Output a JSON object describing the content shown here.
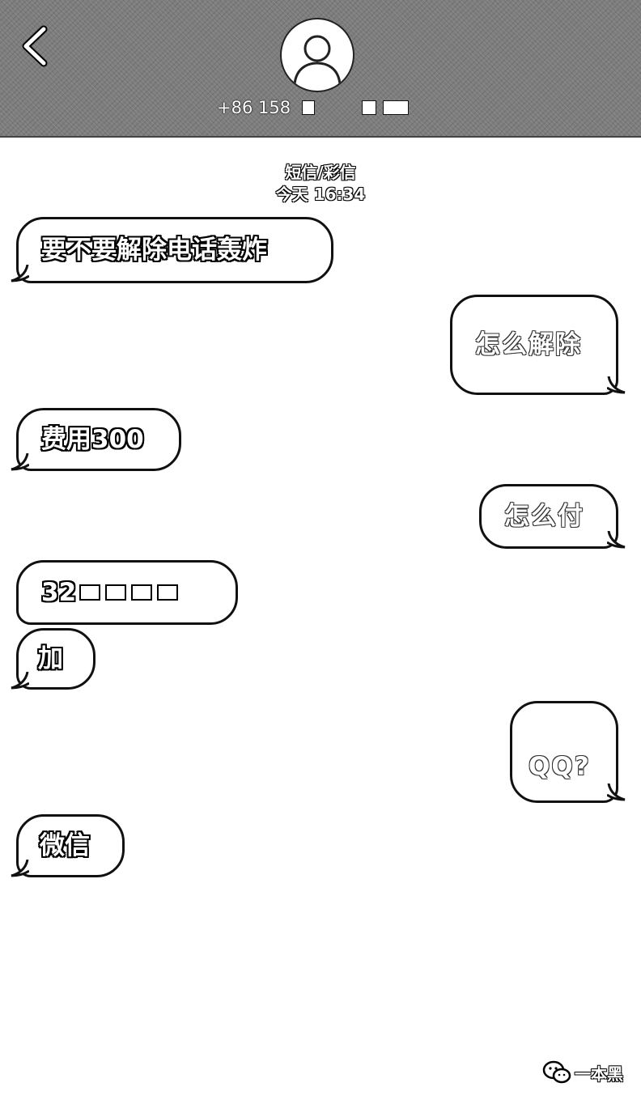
{
  "header": {
    "contact_number": "+86 158",
    "number_redacted": true
  },
  "thread": {
    "type": "短信/彩信",
    "timestamp": "今天 16:34"
  },
  "messages": [
    {
      "direction": "incoming",
      "text": "要不要解除电话轰炸"
    },
    {
      "direction": "outgoing",
      "text": "怎么解除"
    },
    {
      "direction": "incoming",
      "text": "费用300"
    },
    {
      "direction": "outgoing",
      "text": "怎么付"
    },
    {
      "direction": "incoming",
      "text": "32",
      "partially_redacted": true
    },
    {
      "direction": "incoming",
      "text": "加"
    },
    {
      "direction": "outgoing",
      "text": "QQ?"
    },
    {
      "direction": "incoming",
      "text": "微信"
    }
  ],
  "watermark": {
    "text": "一本黑",
    "icon": "wechat-icon"
  },
  "colors": {
    "header_bg": "#7d7d7d",
    "bubble_bg": "#ffffff",
    "outline": "#111111"
  }
}
